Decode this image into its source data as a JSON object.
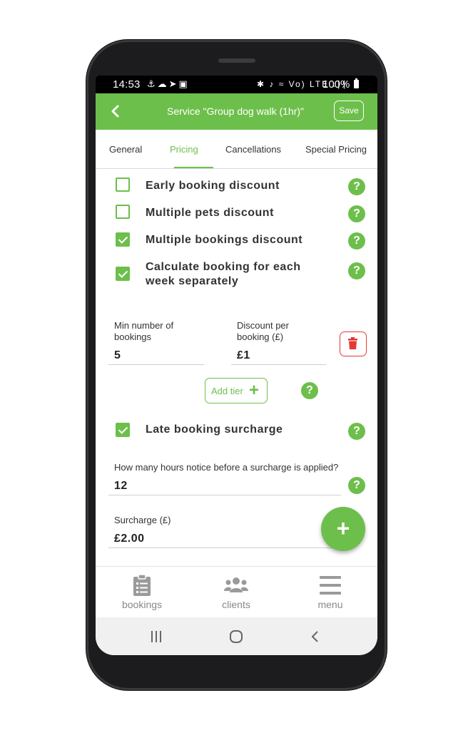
{
  "status_bar": {
    "time": "14:53",
    "left_icons": "⚓☁➤▣",
    "right_icons": "✱ ♪ ≈ Vo) LTE .∣∣",
    "battery": "100%"
  },
  "app_bar": {
    "title": "Service \"Group dog walk (1hr)\"",
    "save_label": "Save"
  },
  "tabs": [
    {
      "label": "General"
    },
    {
      "label": "Pricing"
    },
    {
      "label": "Cancellations"
    },
    {
      "label": "Special Pricing"
    }
  ],
  "options": {
    "early_booking": {
      "label": "Early booking discount",
      "checked": false
    },
    "multiple_pets": {
      "label": "Multiple pets discount",
      "checked": false
    },
    "multiple_bookings": {
      "label": "Multiple bookings discount",
      "checked": true
    },
    "calc_weekly_line1": "Calculate booking for each",
    "calc_weekly_line2": "week separately",
    "late_booking": {
      "label": "Late booking surcharge",
      "checked": true
    }
  },
  "tier": {
    "min_label_line1": "Min number of",
    "min_label_line2": "bookings",
    "min_value": "5",
    "discount_label_line1": "Discount per",
    "discount_label_line2": "booking (£)",
    "discount_value": "£1"
  },
  "add_tier_label": "Add tier",
  "surcharge": {
    "hours_label": "How many hours notice before a surcharge is applied?",
    "hours_value": "12",
    "amount_label": "Surcharge (£)",
    "amount_value": "£2.00"
  },
  "help_glyph": "?",
  "fab_glyph": "+",
  "bottom_nav": [
    {
      "label": "bookings",
      "icon": "clipboard-icon"
    },
    {
      "label": "clients",
      "icon": "users-icon"
    },
    {
      "label": "menu",
      "icon": "hamburger-menu-icon"
    }
  ],
  "colors": {
    "accent": "#6dbf4b",
    "danger": "#e53935",
    "nav_icon": "#9a9a9a"
  }
}
